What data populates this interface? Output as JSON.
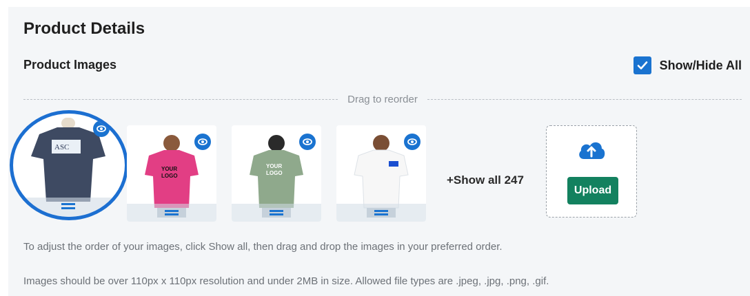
{
  "page_title": "Product Details",
  "section_title": "Product Images",
  "show_hide": {
    "label": "Show/Hide All",
    "checked": true
  },
  "reorder_label": "Drag to reorder",
  "images": [
    {
      "shirt_color": "#3e4a62",
      "alt": "navy t-shirt with logo"
    },
    {
      "shirt_color": "#e23e84",
      "alt": "pink t-shirt worn by model"
    },
    {
      "shirt_color": "#8fa98c",
      "alt": "sage t-shirt back view"
    },
    {
      "shirt_color": "#f7f7f7",
      "alt": "white t-shirt worn by model"
    }
  ],
  "show_all_label": "+Show all 247",
  "upload_label": "Upload",
  "notes": [
    "To adjust the order of your images, click Show all, then drag and drop the images in your preferred order.",
    "Images should be over 110px x 110px resolution and under 2MB in size. Allowed file types are .jpeg, .jpg, .png, .gif."
  ],
  "colors": {
    "accent": "#1a73d0",
    "upload": "#13815f",
    "panel": "#f4f6f8"
  }
}
